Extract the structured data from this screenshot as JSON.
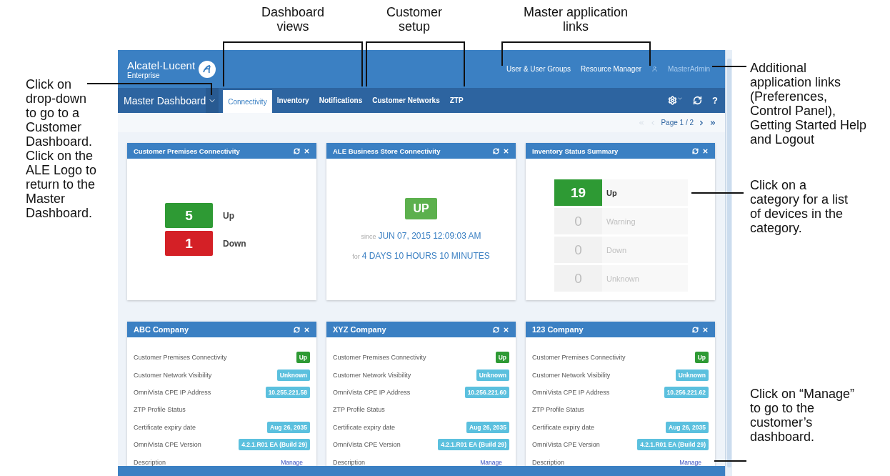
{
  "annotations": {
    "top": [
      "Dashboard views",
      "Customer setup",
      "Master application links"
    ],
    "left": "Click on drop-down to go to a Customer Dashboard. Click on the ALE Logo to return to the Master Dashboard.",
    "right": [
      "Additional application links (Preferences, Control Panel), Getting Started Help and Logout",
      "Click on a category for a list of devices in the category.",
      "Click on “Manage” to go to the customer’s dashboard."
    ]
  },
  "header": {
    "logo": "Alcatel·Lucent",
    "logo_sub": "Enterprise",
    "links": [
      "User & User Groups",
      "Resource Manager"
    ],
    "user": "MasterAdmin"
  },
  "nav": {
    "dashboard": "Master Dashboard",
    "tabs": [
      {
        "label": "Connectivity",
        "selected": true
      },
      {
        "label": "Inventory",
        "selected": false
      },
      {
        "label": "Notifications",
        "selected": false
      },
      {
        "label": "Customer Networks",
        "selected": false
      },
      {
        "label": "ZTP",
        "selected": false
      }
    ],
    "help": "?"
  },
  "pager": {
    "label": "Page 1 / 2"
  },
  "widgets": [
    {
      "kind": "counts",
      "title": "Customer Premises Connectivity",
      "items": [
        {
          "count": "5",
          "label": "Up",
          "color": "#2e9a34"
        },
        {
          "count": "1",
          "label": "Down",
          "color": "#d42026"
        }
      ]
    },
    {
      "kind": "status",
      "title": "ALE Business Store Connectivity",
      "badge": "UP",
      "since_label": "since",
      "since": "JUN 07, 2015 12:09:03 AM",
      "for_label": "for",
      "duration": "4 DAYS 10 HOURS 10 MINUTES"
    },
    {
      "kind": "inventory",
      "title": "Inventory Status Summary",
      "items": [
        {
          "count": "19",
          "label": "Up",
          "active": true
        },
        {
          "count": "0",
          "label": "Warning",
          "active": false
        },
        {
          "count": "0",
          "label": "Down",
          "active": false
        },
        {
          "count": "0",
          "label": "Unknown",
          "active": false
        }
      ]
    },
    {
      "kind": "company",
      "title": "ABC Company",
      "rows": [
        {
          "label": "Customer Premises Connectivity",
          "value": "Up",
          "kind": "ok"
        },
        {
          "label": "Customer Network Visibility",
          "value": "Unknown",
          "kind": "info"
        },
        {
          "label": "OmniVista CPE IP Address",
          "value": "10.255.221.58",
          "kind": "info"
        },
        {
          "label": "ZTP Profile Status",
          "kind": "none"
        },
        {
          "label": "Certificate expiry date",
          "value": "Aug 26, 2035",
          "kind": "info"
        },
        {
          "label": "OmniVista CPE Version",
          "value": "4.2.1.R01 EA (Build 29)",
          "kind": "info"
        },
        {
          "label": "Description",
          "value": "Manage",
          "kind": "link"
        }
      ]
    },
    {
      "kind": "company",
      "title": "XYZ Company",
      "rows": [
        {
          "label": "Customer Premises Connectivity",
          "value": "Up",
          "kind": "ok"
        },
        {
          "label": "Customer Network Visibility",
          "value": "Unknown",
          "kind": "info"
        },
        {
          "label": "OmniVista CPE IP Address",
          "value": "10.256.221.60",
          "kind": "info"
        },
        {
          "label": "ZTP Profile Status",
          "kind": "none"
        },
        {
          "label": "Certificate expiry date",
          "value": "Aug 26, 2035",
          "kind": "info"
        },
        {
          "label": "OmniVista CPE Version",
          "value": "4.2.1.R01 EA (Build 29)",
          "kind": "info"
        },
        {
          "label": "Description",
          "value": "Manage",
          "kind": "link"
        }
      ]
    },
    {
      "kind": "company",
      "title": "123 Company",
      "rows": [
        {
          "label": "Customer Premises Connectivity",
          "value": "Up",
          "kind": "ok"
        },
        {
          "label": "Customer Network Visibility",
          "value": "Unknown",
          "kind": "info"
        },
        {
          "label": "OmniVista CPE IP Address",
          "value": "10.256.221.62",
          "kind": "info"
        },
        {
          "label": "ZTP Profile Status",
          "kind": "none"
        },
        {
          "label": "Certificate expiry date",
          "value": "Aug 26, 2035",
          "kind": "info"
        },
        {
          "label": "OmniVista CPE Version",
          "value": "4.2.1.R01 EA (Build 29)",
          "kind": "info"
        },
        {
          "label": "Description",
          "value": "Manage",
          "kind": "link"
        }
      ]
    }
  ]
}
